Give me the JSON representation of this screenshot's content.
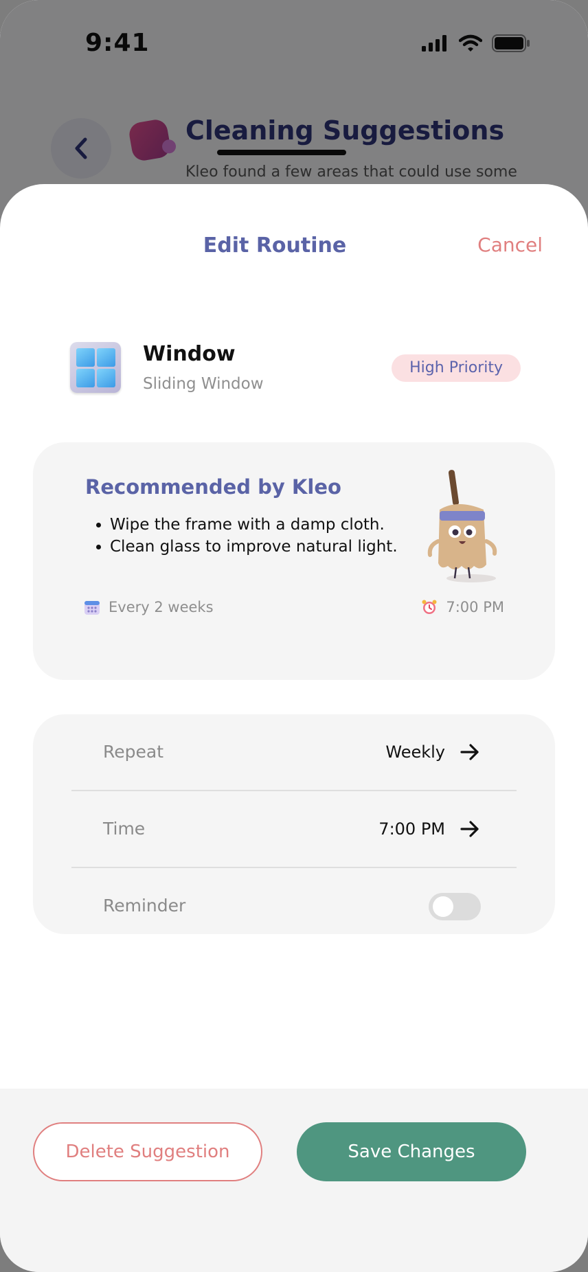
{
  "status_bar": {
    "time": "9:41"
  },
  "background": {
    "title": "Cleaning Suggestions",
    "subtitle": "Kleo found a few areas that could use some"
  },
  "sheet": {
    "title": "Edit Routine",
    "cancel_label": "Cancel"
  },
  "item": {
    "name": "Window",
    "subtitle": "Sliding Window",
    "priority": "High Priority",
    "icon": "window-icon"
  },
  "recommendation": {
    "title": "Recommended by Kleo",
    "tips": [
      "Wipe the frame with a damp cloth.",
      "Clean glass to improve natural light."
    ],
    "frequency": "Every 2 weeks",
    "time": "7:00 PM",
    "mascot": "broom-mascot"
  },
  "settings": {
    "repeat": {
      "label": "Repeat",
      "value": "Weekly"
    },
    "time": {
      "label": "Time",
      "value": "7:00 PM"
    },
    "reminder": {
      "label": "Reminder",
      "enabled": false
    }
  },
  "footer": {
    "delete_label": "Delete Suggestion",
    "save_label": "Save Changes"
  },
  "colors": {
    "accent": "#5a63a6",
    "danger": "#e07f7f",
    "primary": "#4f9680",
    "priority_bg": "#fbe0e2"
  }
}
